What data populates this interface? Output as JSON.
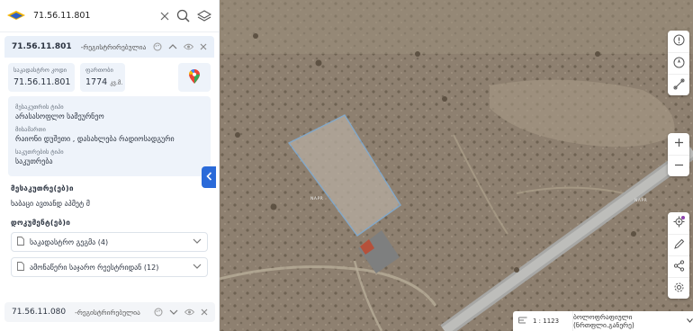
{
  "search": {
    "value": "71.56.11.801"
  },
  "parcel": {
    "code": "71.56.11.801",
    "status": "-რეგისტრირებულია",
    "cadastral_label": "საკადასტრო კოდი",
    "cadastral_value": "71.56.11.801",
    "area_label": "ფართობი",
    "area_value": "1774",
    "area_unit": "კვ.მ.",
    "owner_type_label": "მესაკუთრის ტიპი",
    "owner_type_value": "არასასოფლო სამეურნეო",
    "address_label": "მისამართი",
    "address_value": "რაიონი დუშეთი , დასახლება რადიოსადგური",
    "ownership_label": "საკუთრების ტიპი",
    "ownership_value": "საკუთრება"
  },
  "owners": {
    "title": "მესაკუთრე(ებ)ი",
    "text": "ხაბაცი ავთანდ აპმეტ მ"
  },
  "documents": {
    "title": "დოკუმენტ(ებ)ი",
    "items": [
      {
        "label": "საკადასტრო გეგმა (4)"
      },
      {
        "label": "ამონაწერი საჯარო რეესტრიდან (12)"
      }
    ]
  },
  "parcel2": {
    "code": "71.56.11.080",
    "status": "-რეგისტრირებულია"
  },
  "map": {
    "scale": "1 : 1123",
    "basemap": "ბოლოფრაფიული (ნრთფლი.განერე)",
    "label_1": "NAPR",
    "label_2": "NAPR"
  },
  "colors": {
    "accent": "#2a6ad9",
    "panel_bg": "#eef3fa",
    "parcel_outline": "#7fb6e8"
  }
}
